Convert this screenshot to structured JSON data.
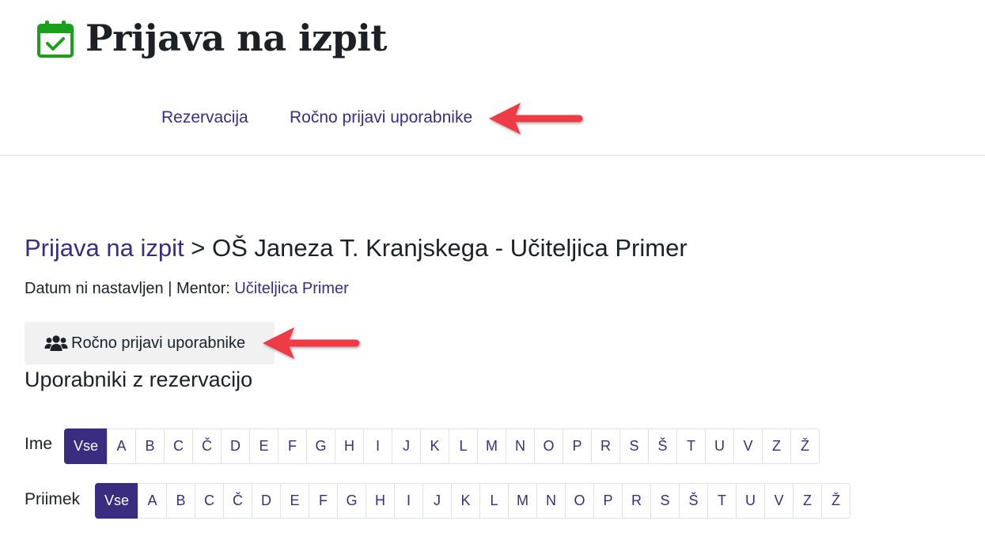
{
  "header": {
    "title": "Prijava na izpit",
    "icon": "calendar-check-icon",
    "icon_color": "#1aa01a",
    "nav": [
      {
        "label": "Rezervacija"
      },
      {
        "label": "Ročno prijavi uporabnike"
      }
    ]
  },
  "breadcrumb": {
    "link": "Prijava na izpit",
    "separator": ">",
    "current": "OŠ Janeza T. Kranjskega - Učiteljica Primer"
  },
  "meta": {
    "date": "Datum ni nastavljen",
    "separator": "|",
    "mentor_label": "Mentor:",
    "mentor_name": "Učiteljica Primer"
  },
  "manual_button": {
    "label": "Ročno prijavi uporabnike",
    "icon": "users-icon"
  },
  "section_title": "Uporabniki z rezervacijo",
  "filters": {
    "first_name": {
      "label": "Ime",
      "active": "Vse",
      "letters": [
        "Vse",
        "A",
        "B",
        "C",
        "Č",
        "D",
        "E",
        "F",
        "G",
        "H",
        "I",
        "J",
        "K",
        "L",
        "M",
        "N",
        "O",
        "P",
        "R",
        "S",
        "Š",
        "T",
        "U",
        "V",
        "Z",
        "Ž"
      ]
    },
    "last_name": {
      "label": "Priimek",
      "active": "Vse",
      "letters": [
        "Vse",
        "A",
        "B",
        "C",
        "Č",
        "D",
        "E",
        "F",
        "G",
        "H",
        "I",
        "J",
        "K",
        "L",
        "M",
        "N",
        "O",
        "P",
        "R",
        "S",
        "Š",
        "T",
        "U",
        "V",
        "Z",
        "Ž"
      ]
    }
  },
  "colors": {
    "link": "#3a2d80",
    "active_bg": "#3a2d80",
    "annotation_arrow": "#ef3b45",
    "button_bg": "#f1f1f1"
  }
}
